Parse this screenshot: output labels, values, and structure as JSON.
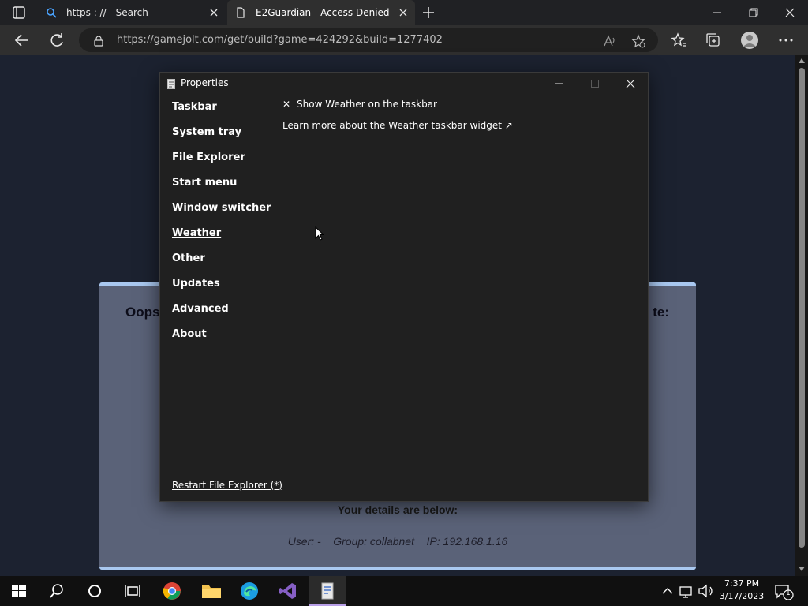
{
  "browser": {
    "tabs": [
      {
        "label": "https : // - Search"
      },
      {
        "label": "E2Guardian - Access Denied"
      }
    ],
    "url": "https://gamejolt.com/get/build?game=424292&build=1277402"
  },
  "page": {
    "heading_left": "Oops",
    "heading_right": "te:",
    "details_title": "Your details are below:",
    "details_line": "User: -    Group: collabnet    IP: 192.168.1.16"
  },
  "dialog": {
    "title": "Properties",
    "sidebar": [
      {
        "label": "Taskbar"
      },
      {
        "label": "System tray"
      },
      {
        "label": "File Explorer"
      },
      {
        "label": "Start menu"
      },
      {
        "label": "Window switcher"
      },
      {
        "label": "Weather"
      },
      {
        "label": "Other"
      },
      {
        "label": "Updates"
      },
      {
        "label": "Advanced"
      },
      {
        "label": "About"
      }
    ],
    "active_item": "Weather",
    "option_label": "Show Weather on the taskbar",
    "option_mark": "✕",
    "learn_more": "Learn more about the Weather taskbar widget ↗",
    "restart_link": "Restart File Explorer (*)"
  },
  "taskbar": {
    "time": "7:37 PM",
    "date": "3/17/2023",
    "notification_count": "1",
    "apps": [
      "windows-start",
      "search",
      "cortana",
      "task-view",
      "chrome",
      "file-explorer",
      "edge",
      "visual-studio",
      "properties-app"
    ]
  },
  "colors": {
    "page_bg": "#1c2230",
    "card_bg": "#5a6278",
    "card_border": "#a9c8f0",
    "dialog_bg": "#202020",
    "taskbar_bg": "#101010",
    "active_app_indicator": "#b9a0e8"
  }
}
